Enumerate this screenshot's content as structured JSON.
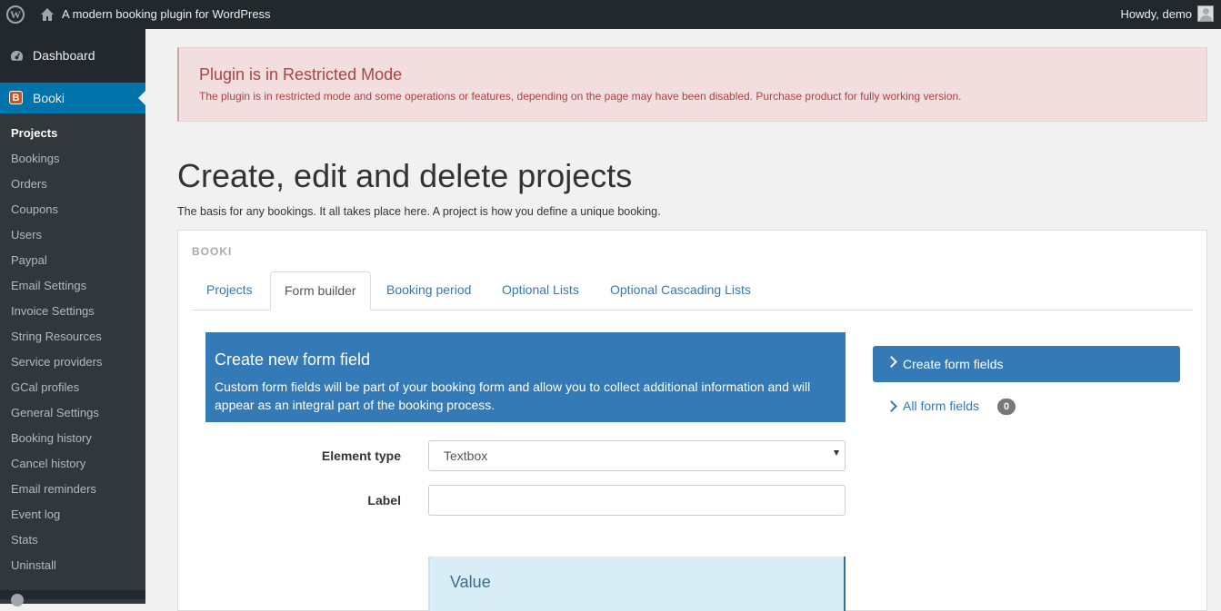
{
  "adminbar": {
    "site_title": "A modern booking plugin for WordPress",
    "howdy": "Howdy, demo"
  },
  "sidebar": {
    "dashboard": "Dashboard",
    "plugin": "Booki",
    "submenu": [
      "Projects",
      "Bookings",
      "Orders",
      "Coupons",
      "Users",
      "Paypal",
      "Email Settings",
      "Invoice Settings",
      "String Resources",
      "Service providers",
      "GCal profiles",
      "General Settings",
      "Booking history",
      "Cancel history",
      "Email reminders",
      "Event log",
      "Stats",
      "Uninstall"
    ],
    "current": "Projects"
  },
  "notice": {
    "title": "Plugin is in Restricted Mode",
    "text": "The plugin is in restricted mode and some operations or features, depending on the page may have been disabled. Purchase product for fully working version."
  },
  "page": {
    "title": "Create, edit and delete projects",
    "intro": "The basis for any bookings. It all takes place here. A project is how you define a unique booking."
  },
  "panel": {
    "heading": "BOOKI",
    "tabs": [
      "Projects",
      "Form builder",
      "Booking period",
      "Optional Lists",
      "Optional Cascading Lists"
    ],
    "active_tab": "Form builder"
  },
  "form": {
    "box_title": "Create new form field",
    "box_text": "Custom form fields will be part of your booking form and allow you to collect additional information and will appear as an integral part of the booking process.",
    "element_type_label": "Element type",
    "element_type_value": "Textbox",
    "label_label": "Label",
    "label_value": "",
    "value_title": "Value"
  },
  "actions": {
    "create_label": "Create form fields",
    "all_label": "All form fields",
    "all_count": "0"
  },
  "colors": {
    "primary": "#337ab7",
    "admin_dark": "#23282d",
    "wp_blue": "#0073aa",
    "danger_bg": "#f2dede",
    "danger_text": "#a94442"
  }
}
